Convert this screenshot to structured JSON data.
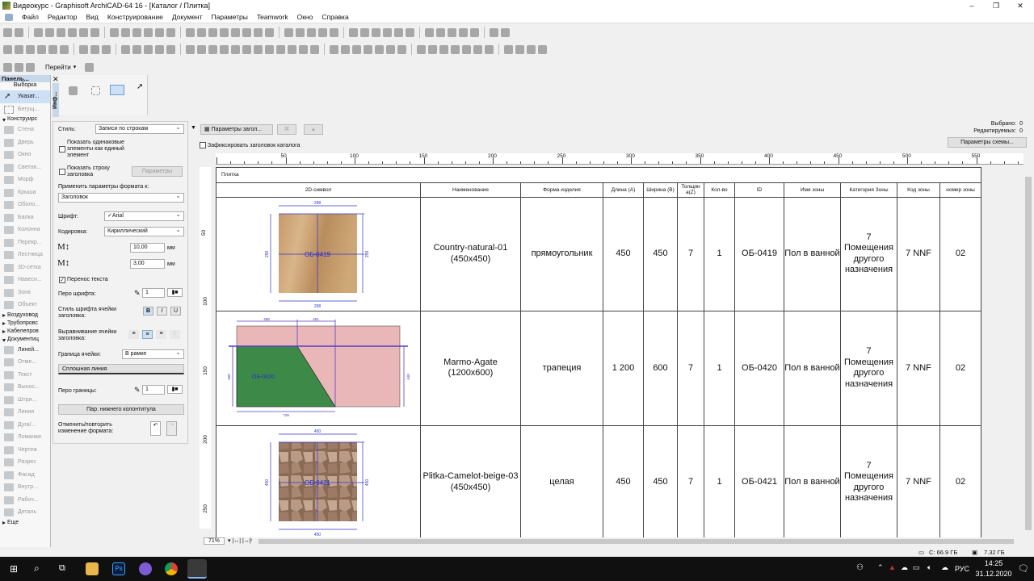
{
  "window": {
    "title": "Видеокурс - Graphisoft ArchiCAD-64 16 - [Каталог /  Плитка]"
  },
  "menu": [
    "Файл",
    "Редактор",
    "Вид",
    "Конструирование",
    "Документ",
    "Параметры",
    "Teamwork",
    "Окно",
    "Справка"
  ],
  "toolbar": {
    "goto_label": "Перейти"
  },
  "toolbox": {
    "title": "Панель...",
    "selection": "Выборка",
    "pointer": "Указат...",
    "marquee": "Бегущ...",
    "section_design": "Конструирс",
    "design_tools": [
      "Стена",
      "Дверь",
      "Окно",
      "Светов...",
      "Морф",
      "Крыша",
      "Оболо...",
      "Балка",
      "Колонна",
      "Перекр...",
      "Лестница",
      "3D-сетка",
      "Навесн...",
      "Зона",
      "Объект"
    ],
    "sections": [
      "Воздуховод",
      "Трубопровс",
      "Кабелепров"
    ],
    "section_doc": "Документиц",
    "doc_tools": [
      "Линей...",
      "Отме...",
      "Текст",
      "Вынос...",
      "Штри...",
      "Линия",
      "Дуга/...",
      "Ломаная",
      "Чертеж",
      "Разрез",
      "Фасад",
      "Внутр...",
      "Рабоч...",
      "Деталь"
    ],
    "more": "Еще"
  },
  "info": {
    "tab": "Инф...",
    "style_label": "Стиль:",
    "style_value": "Записи по строкам",
    "show_same_label": "Показать одинаковые элементы как единый элемент",
    "show_header_label": "Показать строку заголовка",
    "params_button": "Параметры",
    "apply_label": "Применить параметры формата к:",
    "apply_value": "Заголовок",
    "font_label": "Шрифт:",
    "font_value": "✓Arial",
    "encoding_label": "Кодировка:",
    "encoding_value": "Кириллический",
    "size1_value": "10,00",
    "size2_value": "3,00",
    "unit": "мм",
    "wrap_label": "Перенос текста",
    "pen_label": "Перо шрифта:",
    "pen_value": "1",
    "font_style_label": "Стиль шрифта ячейки заголовка:",
    "bold": "B",
    "italic": "I",
    "underline": "U",
    "align_label": "Выравнивание ячейки заголовка:",
    "border_label": "Граница ячейки:",
    "border_value": "В рамке",
    "line_type": "Сплошная линия",
    "border_pen_label": "Перо границы:",
    "border_pen_value": "1",
    "footer_button": "Пар. нижнего колонтитула",
    "undo_label": "Отменить/повторить изменение формата:"
  },
  "schedule": {
    "header_params_button": "Параметры загол...",
    "freeze_label": "Зафиксировать заголовок каталога",
    "selected_label": "Выбрано:",
    "selected_value": "0",
    "editable_label": "Редактируемых:",
    "editable_value": "0",
    "scheme_button": "Параметры схемы...",
    "ruler": [
      "50",
      "100",
      "150",
      "200",
      "250",
      "300",
      "350",
      "400",
      "450",
      "500",
      "550"
    ],
    "vruler": [
      "50",
      "100",
      "150",
      "200",
      "250"
    ],
    "title": "Плитка",
    "columns": [
      "2D-символ",
      "Наименование",
      "Форма изделия",
      "Длина (A)",
      "Ширина (B)",
      "Толщин а(Z)",
      "Кол-во",
      "ID",
      "Имя зоны",
      "Категория Зоны",
      "Код зоны",
      "номер зоны"
    ],
    "rows": [
      {
        "symbol_id": "ОБ-0419",
        "dims": [
          "298",
          "259",
          "259",
          "298"
        ],
        "name": "Country-natural-01 (450x450)",
        "shape": "прямоугольник",
        "length": "450",
        "width": "450",
        "thickness": "7",
        "qty": "1",
        "id": "ОБ-0419",
        "zone_name": "Пол в ванной",
        "zone_cat": "7 Помещения другого назначения",
        "zone_code": "7 NNF",
        "zone_num": "02"
      },
      {
        "symbol_id": "ОБ-0420",
        "dims": [
          "468",
          "261",
          "400",
          "440",
          "729"
        ],
        "name": "Marmo-Agate (1200x600)",
        "shape": "трапеция",
        "length": "1 200",
        "width": "600",
        "thickness": "7",
        "qty": "1",
        "id": "ОБ-0420",
        "zone_name": "Пол в ванной",
        "zone_cat": "7 Помещения другого назначения",
        "zone_code": "7 NNF",
        "zone_num": "02"
      },
      {
        "symbol_id": "ОБ-0421",
        "dims": [
          "450",
          "450",
          "450",
          "450"
        ],
        "name": "Plitka-Camelot-beige-03 (450x450)",
        "shape": "целая",
        "length": "450",
        "width": "450",
        "thickness": "7",
        "qty": "1",
        "id": "ОБ-0421",
        "zone_name": "Пол в ванной",
        "zone_cat": "7 Помещения другого назначения",
        "zone_code": "7 NNF",
        "zone_num": "02"
      }
    ],
    "zoom": "71%"
  },
  "status": {
    "disk": "C: 66.9 ГБ",
    "ram": "7.32 ГБ"
  },
  "taskbar": {
    "lang": "РУС",
    "time": "14:25",
    "date": "31.12.2020"
  }
}
